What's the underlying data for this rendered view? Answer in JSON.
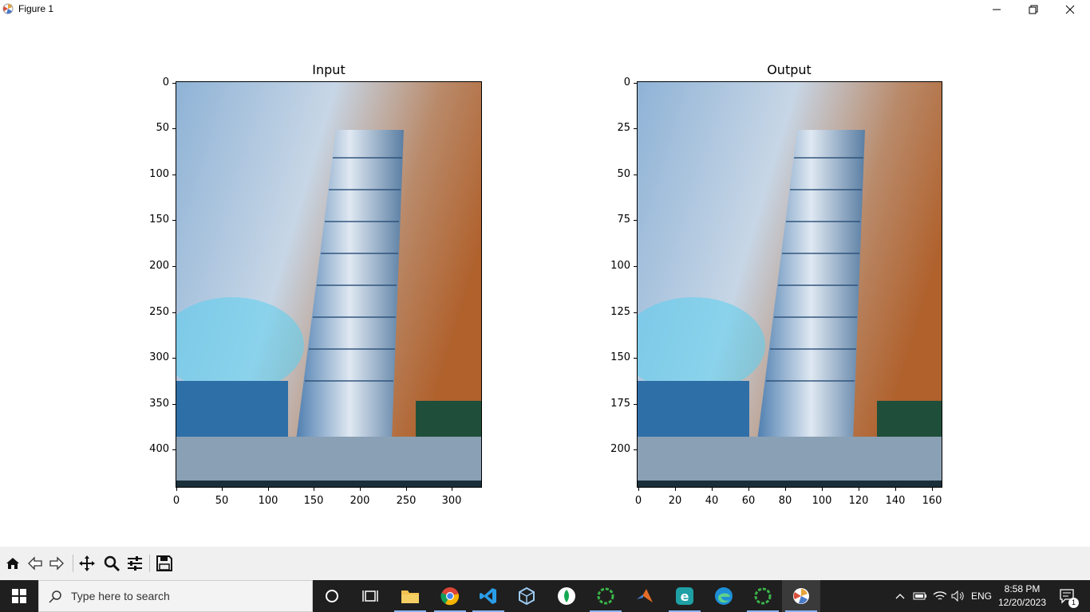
{
  "window": {
    "title": "Figure 1"
  },
  "plots": [
    {
      "title": "Input",
      "yticks": [
        "0",
        "50",
        "100",
        "150",
        "200",
        "250",
        "300",
        "350",
        "400"
      ],
      "xticks": [
        "0",
        "50",
        "100",
        "150",
        "200",
        "250",
        "300"
      ]
    },
    {
      "title": "Output",
      "yticks": [
        "0",
        "25",
        "50",
        "75",
        "100",
        "125",
        "150",
        "175",
        "200"
      ],
      "xticks": [
        "0",
        "20",
        "40",
        "60",
        "80",
        "100",
        "120",
        "140",
        "160"
      ]
    }
  ],
  "toolbar": {
    "icons": [
      "home-icon",
      "back-arrow-icon",
      "forward-arrow-icon",
      "pan-icon",
      "zoom-icon",
      "configure-subplots-icon",
      "save-icon"
    ]
  },
  "taskbar": {
    "search_placeholder": "Type here to search",
    "language": "ENG",
    "time": "8:58 PM",
    "date": "12/20/2023",
    "notification_count": "1"
  }
}
